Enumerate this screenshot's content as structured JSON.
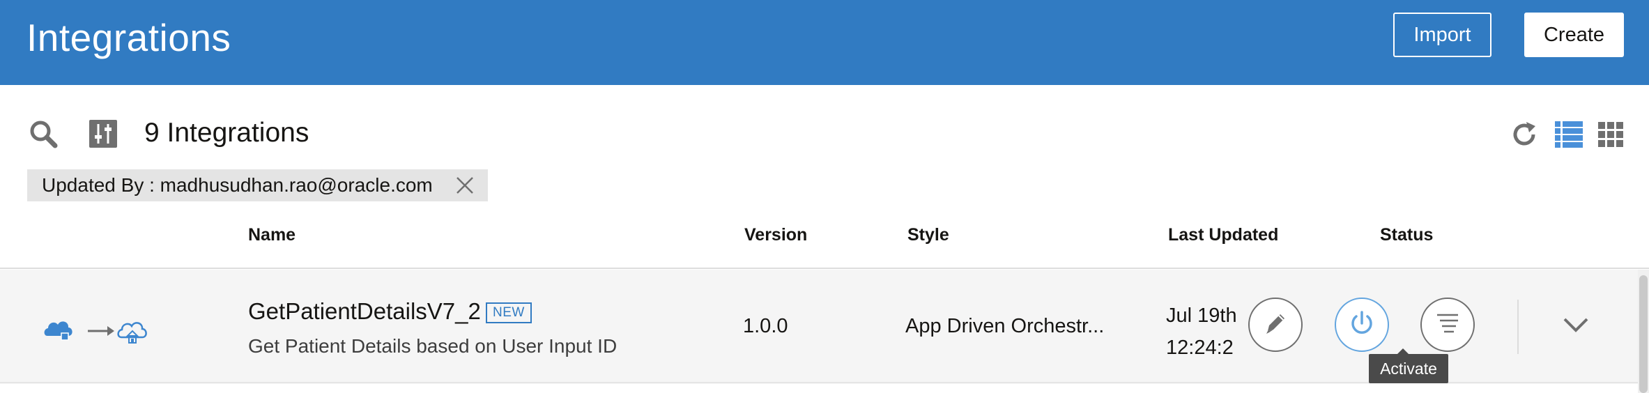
{
  "header": {
    "title": "Integrations",
    "import_label": "Import",
    "create_label": "Create",
    "bg_color": "#317bc2"
  },
  "toolbar": {
    "count_label": "9 Integrations",
    "icons": [
      "search-icon",
      "filter-icon",
      "refresh-icon",
      "list-view-icon",
      "grid-view-icon"
    ]
  },
  "filter_chip": {
    "label": "Updated By : madhusudhan.rao@oracle.com"
  },
  "table": {
    "columns": [
      "Name",
      "Version",
      "Style",
      "Last Updated",
      "Status"
    ],
    "rows": [
      {
        "name": "GetPatientDetailsV7_2",
        "badge": "NEW",
        "description": "Get Patient Details based on User Input ID",
        "version": "1.0.0",
        "style": "App Driven Orchestr...",
        "updated_line1": "Jul 19th",
        "updated_line2": "12:24:2"
      }
    ]
  },
  "tooltip": {
    "activate": "Activate"
  },
  "colors": {
    "accent": "#317bc2",
    "activate_ring": "#63a5df"
  }
}
